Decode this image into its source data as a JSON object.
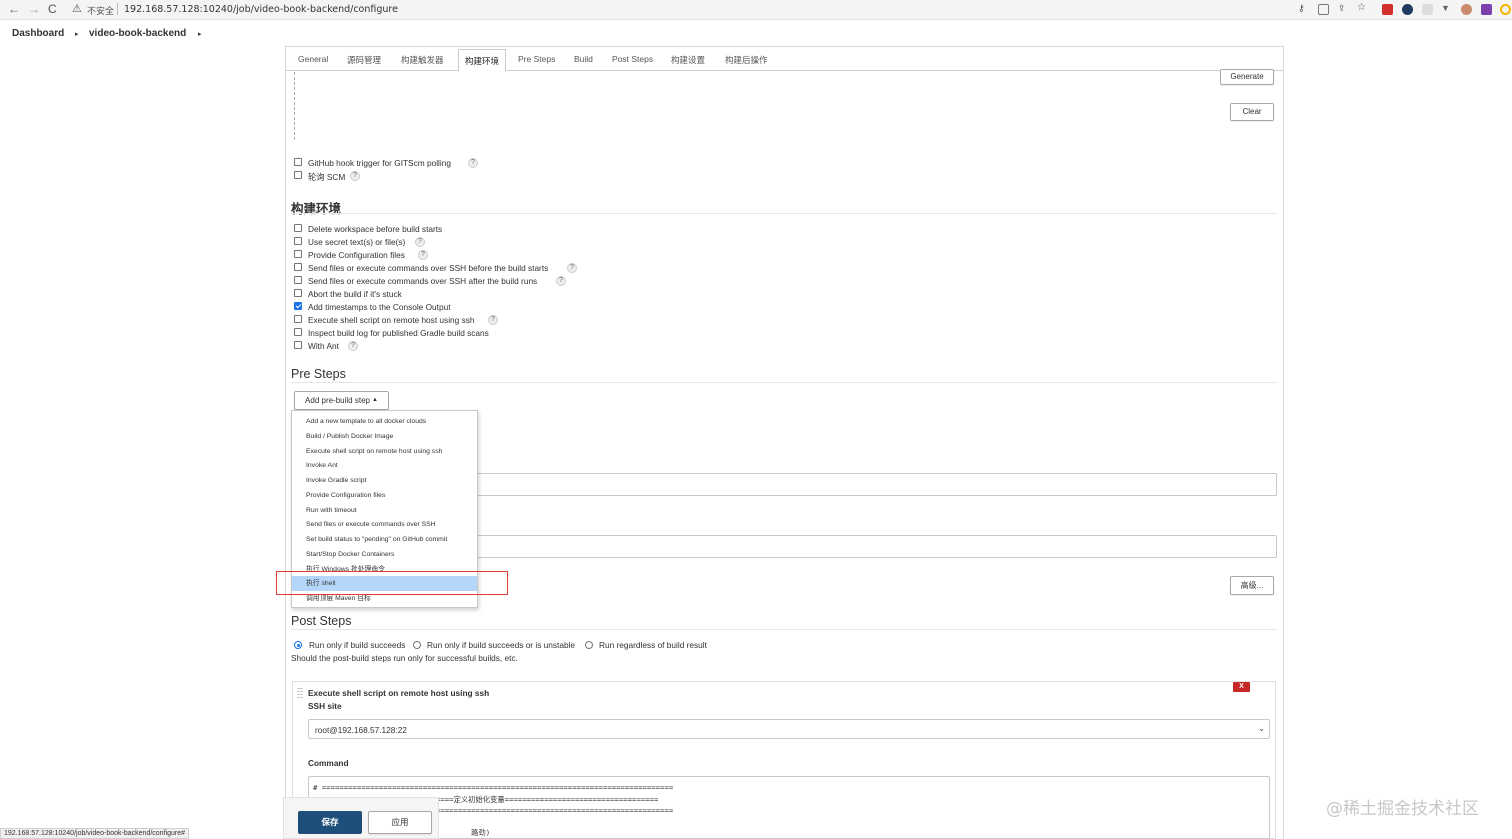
{
  "browser": {
    "back_icon": "←",
    "forward_icon": "→",
    "reload_icon": "C",
    "security_label": "不安全",
    "url": "192.168.57.128:10240/job/video-book-backend/configure"
  },
  "breadcrumb": {
    "dashboard": "Dashboard",
    "job": "video-book-backend",
    "separator": "▸"
  },
  "tabs": [
    "General",
    "源码管理",
    "构建触发器",
    "构建环境",
    "Pre Steps",
    "Build",
    "Post Steps",
    "构建设置",
    "构建后操作"
  ],
  "active_tab": "构建环境",
  "triggers": {
    "generate_button": "Generate",
    "clear_button": "Clear",
    "github_hook": "GitHub hook trigger for GITScm polling",
    "poll_scm": "轮询 SCM"
  },
  "build_env": {
    "title": "构建环境",
    "options": [
      {
        "label": "Delete workspace before build starts",
        "checked": false,
        "help": false
      },
      {
        "label": "Use secret text(s) or file(s)",
        "checked": false,
        "help": true
      },
      {
        "label": "Provide Configuration files",
        "checked": false,
        "help": true
      },
      {
        "label": "Send files or execute commands over SSH before the build starts",
        "checked": false,
        "help": true
      },
      {
        "label": "Send files or execute commands over SSH after the build runs",
        "checked": false,
        "help": true
      },
      {
        "label": "Abort the build if it's stuck",
        "checked": false,
        "help": false
      },
      {
        "label": "Add timestamps to the Console Output",
        "checked": true,
        "help": false
      },
      {
        "label": "Execute shell script on remote host using ssh",
        "checked": false,
        "help": true
      },
      {
        "label": "Inspect build log for published Gradle build scans",
        "checked": false,
        "help": false
      },
      {
        "label": "With Ant",
        "checked": false,
        "help": true
      }
    ]
  },
  "pre_steps": {
    "title": "Pre Steps",
    "add_button": "Add pre-build step",
    "menu_items": [
      "Add a new template to all docker clouds",
      "Build / Publish Docker Image",
      "Execute shell script on remote host using ssh",
      "Invoke Ant",
      "Invoke Gradle script",
      "Provide Configuration files",
      "Run with timeout",
      "Send files or execute commands over SSH",
      "Set build status to \"pending\" on GitHub commit",
      "Start/Stop Docker Containers",
      "执行 Windows 批处理命令",
      "执行 shell",
      "调用顶层 Maven 目标"
    ],
    "selected_item": "执行 shell",
    "advanced_button": "高级..."
  },
  "post_steps": {
    "title": "Post Steps",
    "radios": [
      {
        "label": "Run only if build succeeds",
        "checked": true
      },
      {
        "label": "Run only if build succeeds or is unstable",
        "checked": false
      },
      {
        "label": "Run regardless of build result",
        "checked": false
      }
    ],
    "description": "Should the post-build steps run only for successful builds, etc.",
    "step_title": "Execute shell script on remote host using ssh",
    "delete_button": "X",
    "ssh_site_label": "SSH site",
    "ssh_site_value": "root@192.168.57.128:22",
    "command_label": "Command",
    "command_lines": [
      "# ================================================================================",
      "# ==============================定义初始化变量===================================",
      "# ================================================================================",
      "                                    路劲)"
    ]
  },
  "footer": {
    "save_button": "保存",
    "apply_button": "应用",
    "status_url": "192.168.57.128:10240/job/video-book-backend/configure#"
  },
  "watermark": "@稀土掘金技术社区",
  "colors": {
    "accent_blue": "#1a73e8",
    "save_button_bg": "#1e4f7a",
    "highlight_red": "#e53935",
    "menu_selected": "#b4d6fb",
    "delete_red": "#c62828"
  }
}
